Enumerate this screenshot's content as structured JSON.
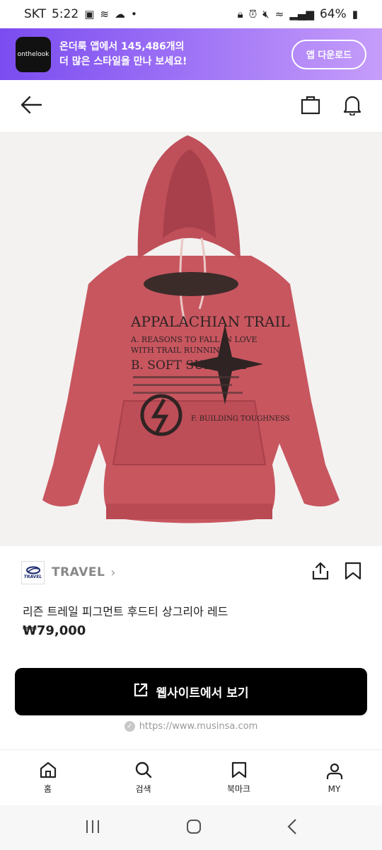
{
  "status_bar": {
    "carrier": "SKT",
    "time": "5:22",
    "battery": "64%"
  },
  "banner": {
    "logo_text": "onthelook",
    "message_line1": "온더룩 앱에서 145,486개의",
    "message_line2": "더 많은 스타일을 만나 보세요!",
    "button_label": "앱 다운로드"
  },
  "product": {
    "brand": "TRAVEL",
    "brand_logo_text": "TRAVEL",
    "name": "리즌 트레일 피그먼트 후드티 상그리아 레드",
    "price": "₩79,000",
    "print_lines": [
      "APPALACHIAN TRAIL",
      "A. REASONS TO FALL IN LOVE",
      "WITH TRAIL RUNNING",
      "B. SOFT SURFACE",
      "F. BUILDING TOUGHNESS"
    ]
  },
  "cta": {
    "label": "웹사이트에서 보기"
  },
  "source": {
    "url": "https://www.musinsa.com"
  },
  "tabs": [
    {
      "label": "홈"
    },
    {
      "label": "검색"
    },
    {
      "label": "북마크"
    },
    {
      "label": "MY"
    }
  ],
  "colors": {
    "banner_start": "#7b4cf0",
    "banner_end": "#c59dfa",
    "hoodie": "#c8565f",
    "cta_bg": "#000000"
  }
}
